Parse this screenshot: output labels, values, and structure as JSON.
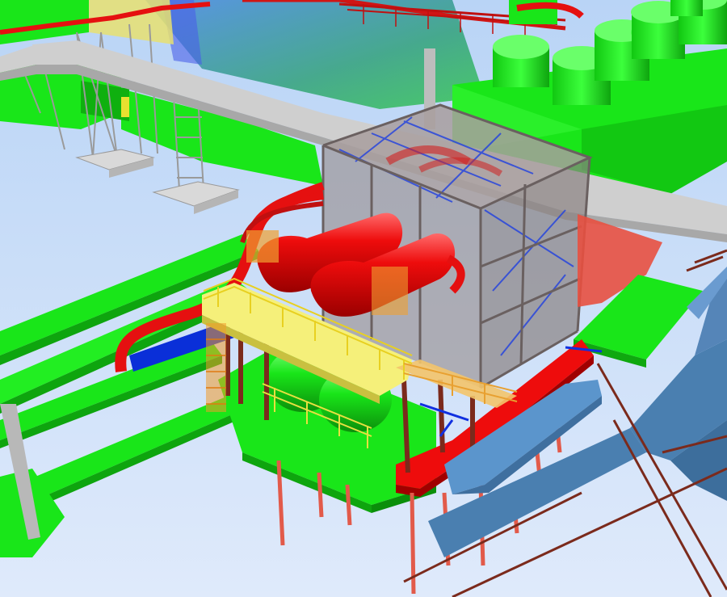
{
  "scene": {
    "kind": "3D plant model render",
    "palette": {
      "sky_top": "#b9d4f6",
      "sky_bottom": "#dfeafb",
      "structure_green": "#19e619",
      "structure_green_dark": "#0fa80f",
      "vessel_red": "#ee0c0c",
      "vessel_red_dark": "#a00000",
      "piperack_grey": "#cfcfcf",
      "enclosure_grey": "#9a8f8f",
      "platform_yellow": "#f5f07a",
      "duct_blue": "#4a7fb0",
      "duct_blue_light": "#5b95cc",
      "water_blue": "#2f7fe0",
      "steel_brown": "#7b2a1c",
      "pile_red": "#e25a4a",
      "pipe_blue": "#0a2fd8"
    }
  }
}
